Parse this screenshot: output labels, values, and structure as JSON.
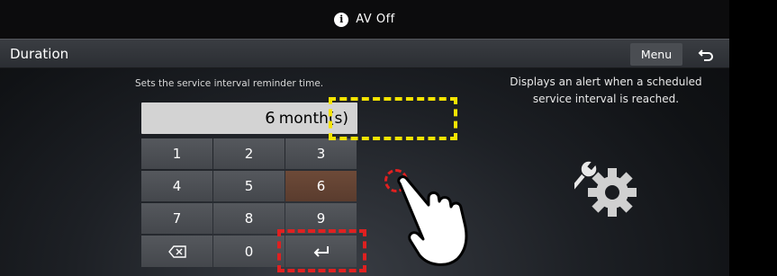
{
  "status_bar": {
    "icon": "info-icon",
    "text": "AV Off"
  },
  "title_bar": {
    "title": "Duration",
    "menu_label": "Menu",
    "back_icon": "back-arrow-icon"
  },
  "content": {
    "description": "Sets the service interval reminder time.",
    "help_text": "Displays an alert when a scheduled service interval is reached.",
    "input": {
      "value": "6",
      "unit": "month(s)"
    }
  },
  "keypad": {
    "keys": [
      "1",
      "2",
      "3",
      "4",
      "5",
      "6",
      "7",
      "8",
      "9",
      "⌫",
      "0",
      "↵"
    ],
    "active_key": "6"
  },
  "colors": {
    "accent_active": "#6d4a38",
    "annotation_yellow": "#f5e400",
    "annotation_red": "#e02020"
  }
}
